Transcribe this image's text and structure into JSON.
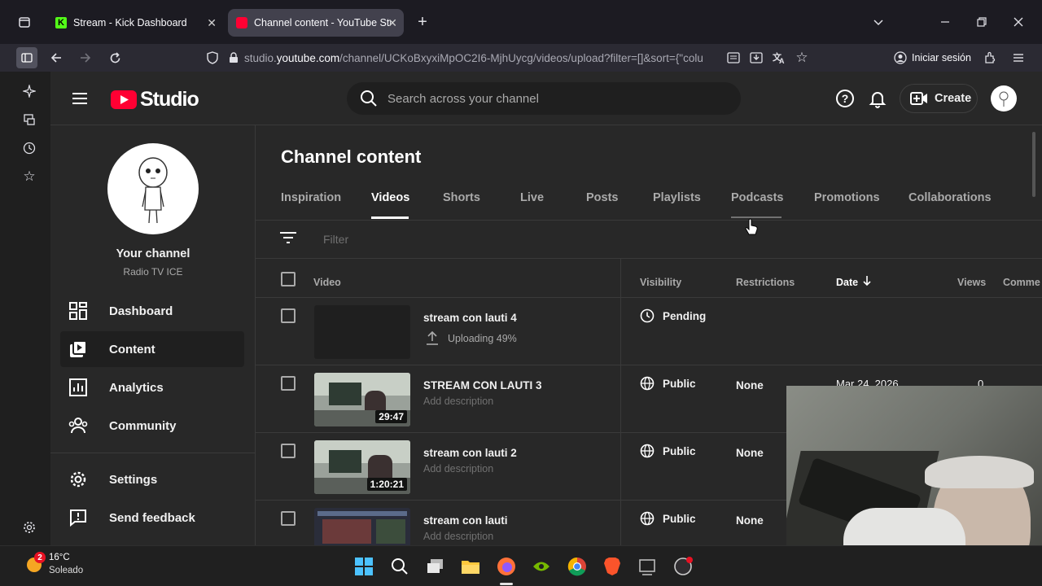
{
  "browser": {
    "tabs": [
      {
        "title": "Stream - Kick Dashboard",
        "active": false
      },
      {
        "title": "Channel content - YouTube Stu",
        "active": true
      }
    ],
    "url_prefix": "studio.",
    "url_domain": "youtube.com",
    "url_rest": "/channel/UCKoBxyxiMpOC2I6-MjhUycg/videos/upload?filter=[]&sort={\"colu",
    "signin_label": "Iniciar sesión"
  },
  "studio": {
    "logo_text": "Studio",
    "search_placeholder": "Search across your channel",
    "create_label": "Create",
    "channel": {
      "label": "Your channel",
      "name": "Radio TV ICE"
    },
    "nav": [
      {
        "label": "Dashboard",
        "icon": "dashboard-icon"
      },
      {
        "label": "Content",
        "icon": "content-icon",
        "active": true
      },
      {
        "label": "Analytics",
        "icon": "analytics-icon"
      },
      {
        "label": "Community",
        "icon": "community-icon"
      },
      {
        "label": "Settings",
        "icon": "settings-icon"
      },
      {
        "label": "Send feedback",
        "icon": "feedback-icon"
      }
    ],
    "page_title": "Channel content",
    "tabs": [
      "Inspiration",
      "Videos",
      "Shorts",
      "Live",
      "Posts",
      "Playlists",
      "Podcasts",
      "Promotions",
      "Collaborations"
    ],
    "active_tab": "Videos",
    "filter_placeholder": "Filter",
    "columns": {
      "video": "Video",
      "visibility": "Visibility",
      "restrictions": "Restrictions",
      "date": "Date",
      "views": "Views",
      "comments": "Comme"
    },
    "videos": [
      {
        "title": "stream con lauti 4",
        "sub": "Uploading 49%",
        "upload_progress": 0.49,
        "duration": "",
        "visibility": "Pending",
        "restrictions": "",
        "date": "",
        "views": ""
      },
      {
        "title": "STREAM CON LAUTI 3",
        "sub": "Add description",
        "duration": "29:47",
        "visibility": "Public",
        "restrictions": "None",
        "date": "Mar 24, 2026",
        "views": "0"
      },
      {
        "title": "stream con lauti 2",
        "sub": "Add description",
        "duration": "1:20:21",
        "visibility": "Public",
        "restrictions": "None",
        "date": "",
        "views": ""
      },
      {
        "title": "stream con lauti",
        "sub": "Add description",
        "duration": "",
        "visibility": "Public",
        "restrictions": "None",
        "date": "",
        "views": ""
      }
    ]
  },
  "taskbar": {
    "weather_temp": "16°C",
    "weather_desc": "Soleado",
    "weather_badge": "2"
  },
  "colors": {
    "accent_red": "#ff0033",
    "bg_dark": "#282828",
    "text_secondary": "#aaaaaa"
  }
}
